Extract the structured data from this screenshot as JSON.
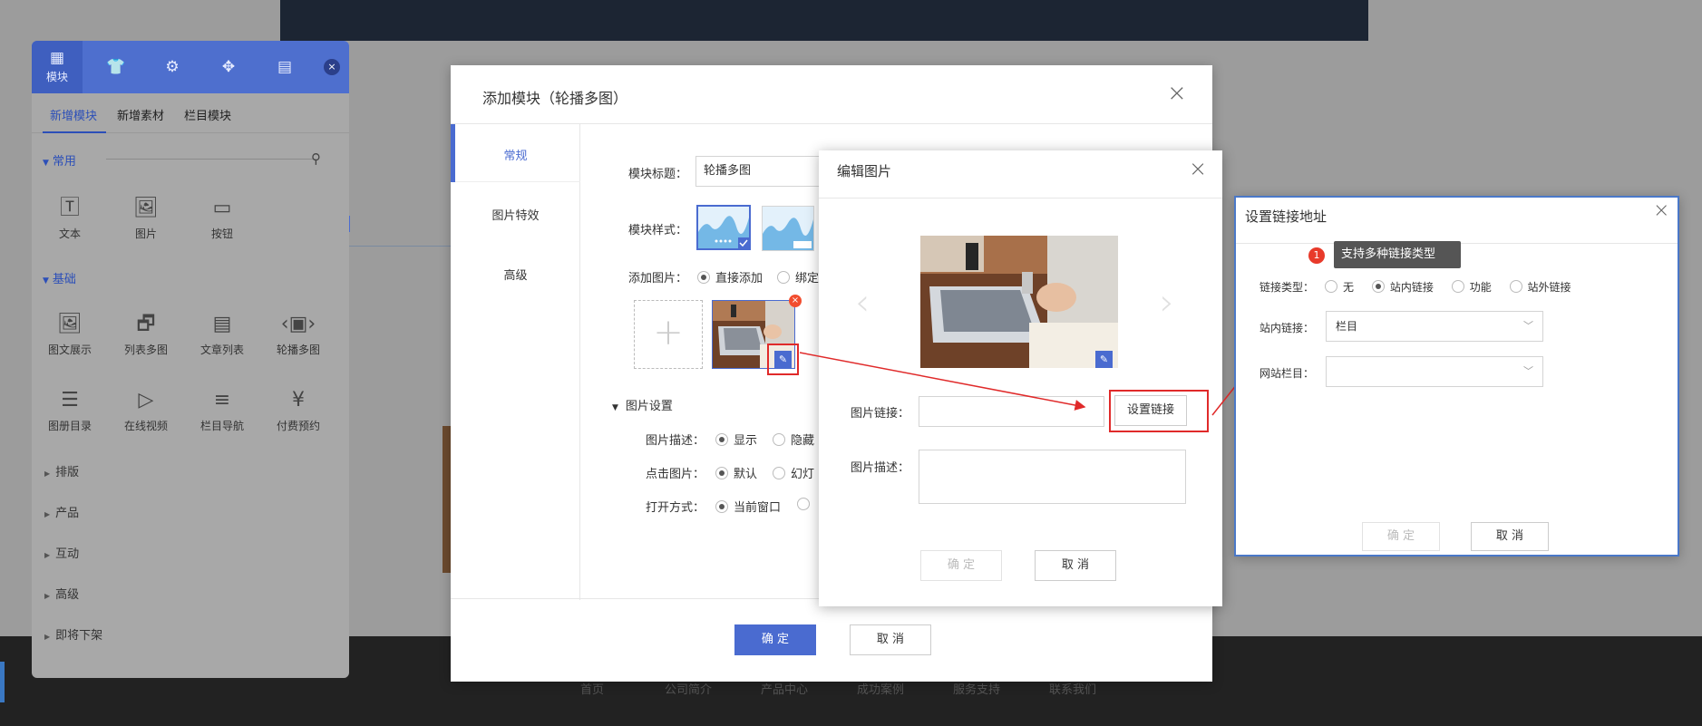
{
  "left_panel": {
    "tabs": [
      {
        "label": "模块",
        "icon": "grid-icon"
      },
      {
        "label": "",
        "icon": "shirt-icon"
      },
      {
        "label": "",
        "icon": "gear-icon"
      },
      {
        "label": "",
        "icon": "paw-icon"
      },
      {
        "label": "",
        "icon": "layout-icon"
      }
    ],
    "close": "×",
    "subtabs": [
      "新增模块",
      "新增素材",
      "栏目模块"
    ],
    "section_common": "常用",
    "section_basic": "基础",
    "common_items": [
      "文本",
      "图片",
      "按钮"
    ],
    "basic_items": [
      "图文展示",
      "列表多图",
      "文章列表",
      "轮播多图",
      "图册目录",
      "在线视频",
      "栏目导航",
      "付费预约"
    ],
    "collapsed": [
      "排版",
      "产品",
      "互动",
      "高级",
      "即将下架"
    ]
  },
  "footer_nav": [
    "首页",
    "公司简介",
    "产品中心",
    "成功案例",
    "服务支持",
    "联系我们"
  ],
  "dialog_module": {
    "title": "添加模块（轮播多图）",
    "close": "×",
    "side": [
      "常规",
      "图片特效",
      "高级"
    ],
    "title_label": "模块标题：",
    "title_value": "轮播多图",
    "style_label": "模块样式：",
    "add_image_label": "添加图片：",
    "add_option_direct": "直接添加",
    "add_option_bind": "绑定",
    "image_settings": "图片设置",
    "desc_label": "图片描述：",
    "desc_show": "显示",
    "desc_hide": "隐藏",
    "click_label": "点击图片：",
    "click_default": "默认",
    "click_slide": "幻灯",
    "open_label": "打开方式：",
    "open_current": "当前窗口",
    "confirm": "确 定",
    "cancel": "取 消"
  },
  "dialog_edit": {
    "title": "编辑图片",
    "close": "×",
    "link_label": "图片链接：",
    "link_value": "",
    "set_link": "设置链接",
    "desc_label": "图片描述：",
    "confirm": "确 定",
    "cancel": "取 消"
  },
  "dialog_link": {
    "title": "设置链接地址",
    "close": "×",
    "tip_number": "1",
    "tooltip": "支持多种链接类型",
    "type_label": "链接类型：",
    "type_options": [
      "无",
      "站内链接",
      "功能",
      "站外链接"
    ],
    "type_selected": "站内链接",
    "internal_label": "站内链接：",
    "internal_value": "栏目",
    "column_label": "网站栏目：",
    "column_value": "",
    "confirm": "确 定",
    "cancel": "取 消"
  },
  "colors": {
    "accent": "#4a6bd0",
    "highlight_red": "#e02a2a",
    "panel_blue": "#4e6fce"
  }
}
